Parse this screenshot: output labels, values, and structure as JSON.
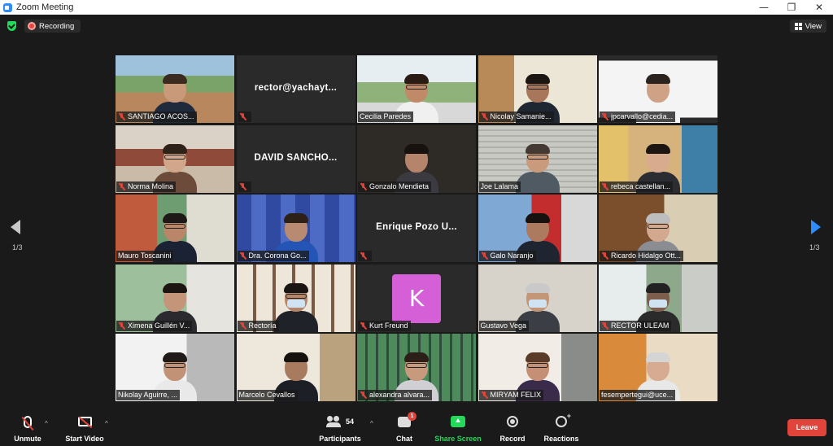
{
  "window": {
    "title": "Zoom Meeting",
    "minimize": "—",
    "restore": "❐",
    "close": "✕"
  },
  "topbar": {
    "recording_label": "Recording",
    "view_label": "View"
  },
  "pagination": {
    "left": "1/3",
    "right": "1/3"
  },
  "participants": [
    {
      "name": "SANTIAGO ACOS...",
      "muted": true,
      "kind": "video",
      "scene": "campus"
    },
    {
      "name": "rector@yachayt...",
      "muted": true,
      "kind": "name"
    },
    {
      "name": "Cecilia Paredes",
      "muted": false,
      "kind": "video",
      "scene": "outdoor"
    },
    {
      "name": "Nicolay Samanie...",
      "muted": true,
      "kind": "video",
      "scene": "office"
    },
    {
      "name": "jpcarvallo@cedia...",
      "muted": true,
      "kind": "video",
      "scene": "white"
    },
    {
      "name": "Norma Molina",
      "muted": true,
      "kind": "video",
      "scene": "hall"
    },
    {
      "name": "DAVID  SANCHO...",
      "muted": true,
      "kind": "name"
    },
    {
      "name": "Gonzalo Mendieta",
      "muted": true,
      "kind": "video",
      "scene": "dark"
    },
    {
      "name": "Joe Lalama",
      "muted": false,
      "kind": "video",
      "scene": "blinds",
      "active": true
    },
    {
      "name": "rebeca castellan...",
      "muted": true,
      "kind": "video",
      "scene": "art"
    },
    {
      "name": "Mauro Toscanini",
      "muted": false,
      "kind": "video",
      "scene": "painting"
    },
    {
      "name": "Dra. Corona  Go...",
      "muted": true,
      "kind": "video",
      "scene": "banner"
    },
    {
      "name": "Enrique Pozo U...",
      "muted": true,
      "kind": "name"
    },
    {
      "name": "Galo Naranjo",
      "muted": true,
      "kind": "video",
      "scene": "uta"
    },
    {
      "name": "Ricardo Hidalgo Ott...",
      "muted": true,
      "kind": "video",
      "scene": "cabinet"
    },
    {
      "name": "Ximena Guillén V...",
      "muted": true,
      "kind": "video",
      "scene": "greenwall"
    },
    {
      "name": "Rectoría",
      "muted": true,
      "kind": "video",
      "scene": "frames"
    },
    {
      "name": "Kurt Freund",
      "muted": true,
      "kind": "avatar",
      "initial": "K"
    },
    {
      "name": "Gustavo Vega",
      "muted": false,
      "kind": "video",
      "scene": "plain"
    },
    {
      "name": "RECTOR ULEAM",
      "muted": true,
      "kind": "video",
      "scene": "window"
    },
    {
      "name": "Nikolay Aguirre, ...",
      "muted": false,
      "kind": "video",
      "scene": "poster"
    },
    {
      "name": "Marcelo Cevallos",
      "muted": false,
      "kind": "video",
      "scene": "shelf"
    },
    {
      "name": "alexandra alvara...",
      "muted": true,
      "kind": "video",
      "scene": "glass"
    },
    {
      "name": "MIRYAM FELIX",
      "muted": true,
      "kind": "video",
      "scene": "curtain"
    },
    {
      "name": "fesempertegui@uce...",
      "muted": false,
      "kind": "video",
      "scene": "mural"
    }
  ],
  "toolbar": {
    "unmute": "Unmute",
    "start_video": "Start Video",
    "participants": "Participants",
    "participants_count": "54",
    "chat": "Chat",
    "chat_badge": "1",
    "share_screen": "Share Screen",
    "record": "Record",
    "reactions": "Reactions",
    "leave": "Leave"
  },
  "colors": {
    "accent_blue": "#2d8cff",
    "share_green": "#23d959",
    "leave_red": "#e0443a",
    "active_speaker": "#c8e63c"
  }
}
